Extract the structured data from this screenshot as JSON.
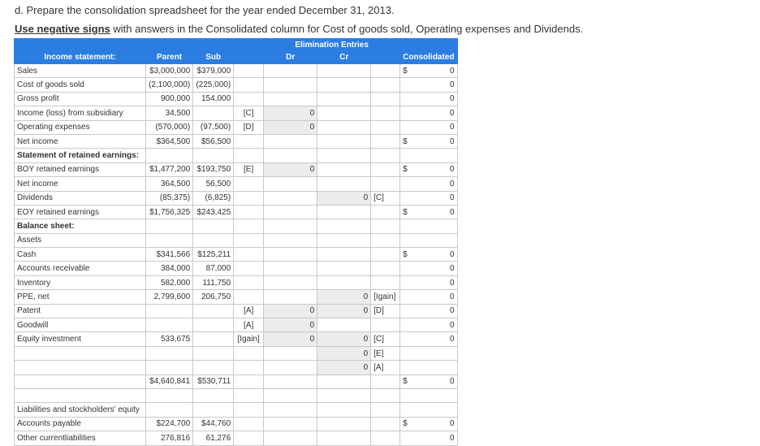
{
  "heading": "d. Prepare the consolidation spreadsheet for the year ended December 31, 2013.",
  "instruction": {
    "underlined": "Use negative signs",
    "rest": " with answers in the Consolidated column for Cost of goods sold, Operating expenses and Dividends."
  },
  "columns": {
    "elim": "Elimination Entries",
    "label": "Income statement:",
    "parent": "Parent",
    "sub": "Sub",
    "dr": "Dr",
    "cr": "Cr",
    "cons": "Consolidated"
  },
  "rows": [
    {
      "label": "Sales",
      "parent": "$3,000,000",
      "sub": "$379,000",
      "drtag": "",
      "dr": "",
      "cr": "",
      "crtag": "",
      "cur": "$",
      "cons": "0"
    },
    {
      "label": "Cost of goods sold",
      "parent": "(2,100,000)",
      "sub": "(225,000)",
      "drtag": "",
      "dr": "",
      "cr": "",
      "crtag": "",
      "cur": "",
      "cons": "0"
    },
    {
      "label": "Gross profit",
      "parent": "900,000",
      "sub": "154,000",
      "drtag": "",
      "dr": "",
      "cr": "",
      "crtag": "",
      "cur": "",
      "cons": "0"
    },
    {
      "label": "Income (loss) from subsidiary",
      "parent": "34,500",
      "sub": "",
      "drtag": "[C]",
      "dr": "0",
      "cr": "",
      "crtag": "",
      "cur": "",
      "cons": "0"
    },
    {
      "label": "Operating expenses",
      "parent": "(570,000)",
      "sub": "(97,500)",
      "drtag": "[D]",
      "dr": "0",
      "cr": "",
      "crtag": "",
      "cur": "",
      "cons": "0"
    },
    {
      "label": "Net income",
      "parent": "$364,500",
      "sub": "$56,500",
      "drtag": "",
      "dr": "",
      "cr": "",
      "crtag": "",
      "cur": "$",
      "cons": "0"
    },
    {
      "label": "Statement of retained earnings:",
      "bold": true,
      "parent": "",
      "sub": "",
      "drtag": "",
      "dr": "",
      "cr": "",
      "crtag": "",
      "cur": "",
      "cons": ""
    },
    {
      "label": "BOY retained earnings",
      "parent": "$1,477,200",
      "sub": "$193,750",
      "drtag": "[E]",
      "dr": "0",
      "cr": "",
      "crtag": "",
      "cur": "$",
      "cons": "0"
    },
    {
      "label": "Net income",
      "parent": "364,500",
      "sub": "56,500",
      "drtag": "",
      "dr": "",
      "cr": "",
      "crtag": "",
      "cur": "",
      "cons": "0"
    },
    {
      "label": "Dividends",
      "parent": "(85,375)",
      "sub": "(6,825)",
      "drtag": "",
      "dr": "",
      "cr": "0",
      "crtag": "[C]",
      "cur": "",
      "cons": "0"
    },
    {
      "label": "EOY retained earnings",
      "parent": "$1,756,325",
      "sub": "$243,425",
      "drtag": "",
      "dr": "",
      "cr": "",
      "crtag": "",
      "cur": "$",
      "cons": "0"
    },
    {
      "label": "Balance sheet:",
      "bold": true,
      "parent": "",
      "sub": "",
      "drtag": "",
      "dr": "",
      "cr": "",
      "crtag": "",
      "cur": "",
      "cons": ""
    },
    {
      "label": "Assets",
      "parent": "",
      "sub": "",
      "drtag": "",
      "dr": "",
      "cr": "",
      "crtag": "",
      "cur": "",
      "cons": ""
    },
    {
      "label": "Cash",
      "parent": "$341,566",
      "sub": "$125,211",
      "drtag": "",
      "dr": "",
      "cr": "",
      "crtag": "",
      "cur": "$",
      "cons": "0"
    },
    {
      "label": "Accounts receivable",
      "parent": "384,000",
      "sub": "87,000",
      "drtag": "",
      "dr": "",
      "cr": "",
      "crtag": "",
      "cur": "",
      "cons": "0"
    },
    {
      "label": "Inventory",
      "parent": "582,000",
      "sub": "111,750",
      "drtag": "",
      "dr": "",
      "cr": "",
      "crtag": "",
      "cur": "",
      "cons": "0"
    },
    {
      "label": "PPE, net",
      "parent": "2,799,600",
      "sub": "206,750",
      "drtag": "",
      "dr": "",
      "cr": "0",
      "crtag": "[Igain]",
      "cur": "",
      "cons": "0"
    },
    {
      "label": "Patent",
      "parent": "",
      "sub": "",
      "drtag": "[A]",
      "dr": "0",
      "cr": "0",
      "crtag": "[D]",
      "cur": "",
      "cons": "0"
    },
    {
      "label": "Goodwill",
      "parent": "",
      "sub": "",
      "drtag": "[A]",
      "dr": "0",
      "cr": "",
      "crtag": "",
      "cur": "",
      "cons": "0"
    },
    {
      "label": "Equity investment",
      "parent": "533,675",
      "sub": "",
      "drtag": "[Igain]",
      "dr": "0",
      "cr": "0",
      "crtag": "[C]",
      "cur": "",
      "cons": "0"
    },
    {
      "label": "",
      "parent": "",
      "sub": "",
      "drtag": "",
      "dr": "",
      "cr": "0",
      "crtag": "[E]",
      "cur": "",
      "cons": ""
    },
    {
      "label": "",
      "parent": "",
      "sub": "",
      "drtag": "",
      "dr": "",
      "cr": "0",
      "crtag": "[A]",
      "cur": "",
      "cons": ""
    },
    {
      "label": "",
      "parent": "$4,640,841",
      "sub": "$530,711",
      "drtag": "",
      "dr": "",
      "cr": "",
      "crtag": "",
      "cur": "$",
      "cons": "0"
    },
    {
      "label": "",
      "parent": "",
      "sub": "",
      "drtag": "",
      "dr": "",
      "cr": "",
      "crtag": "",
      "cur": "",
      "cons": ""
    },
    {
      "label": "Liabilities and stockholders' equity",
      "parent": "",
      "sub": "",
      "drtag": "",
      "dr": "",
      "cr": "",
      "crtag": "",
      "cur": "",
      "cons": ""
    },
    {
      "label": "Accounts payable",
      "parent": "$224,700",
      "sub": "$44,760",
      "drtag": "",
      "dr": "",
      "cr": "",
      "crtag": "",
      "cur": "$",
      "cons": "0"
    },
    {
      "label": "Other currentliabilities",
      "parent": "276,816",
      "sub": "61,276",
      "drtag": "",
      "dr": "",
      "cr": "",
      "crtag": "",
      "cur": "",
      "cons": "0"
    }
  ]
}
